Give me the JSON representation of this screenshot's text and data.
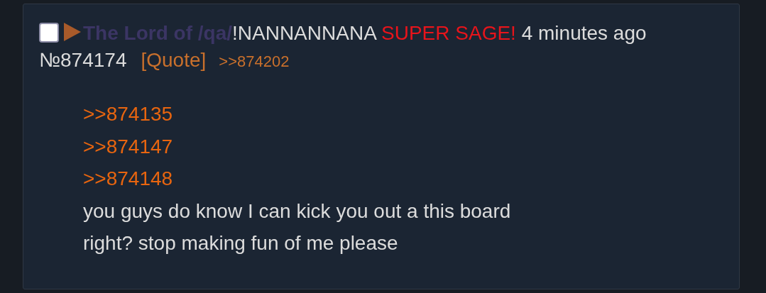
{
  "post": {
    "checked": false,
    "name": "The Lord of /qa/",
    "tripcode": "!NANNANNANA",
    "email_tag": "SUPER SAGE!",
    "time": "4 minutes ago",
    "number": "№874174",
    "quote_link": "[Quote]",
    "backlinks": [
      ">>874202"
    ],
    "message": [
      {
        "kind": "quote",
        "text": ">>874135"
      },
      {
        "kind": "quote",
        "text": ">>874147"
      },
      {
        "kind": "quote",
        "text": ">>874148"
      },
      {
        "kind": "text",
        "text": "you guys do know I can kick you out a this board"
      },
      {
        "kind": "text",
        "text": "right? stop making fun of me please"
      }
    ]
  }
}
